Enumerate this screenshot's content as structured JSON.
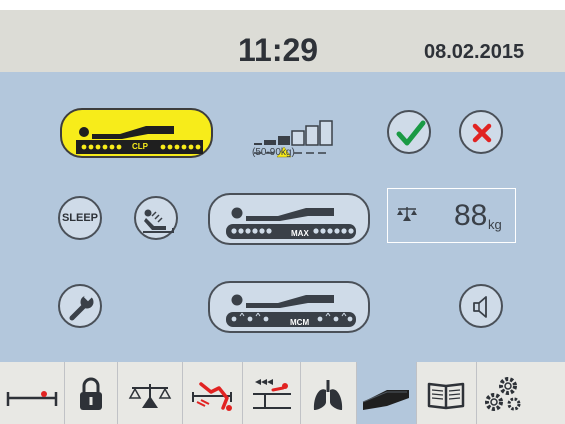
{
  "header": {
    "time": "11:29",
    "date": "08.02.2015"
  },
  "mattress": {
    "clp_label": "CLP",
    "max_label": "MAX",
    "mcm_label": "MCM"
  },
  "weight_range": {
    "label": "(50-90kg)",
    "level": 2,
    "max_level": 5
  },
  "buttons": {
    "sleep_label": "SLEEP"
  },
  "weight": {
    "value": "88",
    "unit": "kg"
  },
  "colors": {
    "background": "#b3c7dc",
    "active_pill": "#f7ec1a",
    "confirm_green": "#1a9a44",
    "cancel_red": "#e12322"
  },
  "tabs": [
    {
      "icon": "bed-flat-icon",
      "active": false
    },
    {
      "icon": "padlock-icon",
      "active": false
    },
    {
      "icon": "scale-icon",
      "active": false
    },
    {
      "icon": "patient-exit-alarm-icon",
      "active": false
    },
    {
      "icon": "patient-position-icon",
      "active": false
    },
    {
      "icon": "lungs-icon",
      "active": false
    },
    {
      "icon": "mattress-icon",
      "active": true
    },
    {
      "icon": "book-icon",
      "active": false
    },
    {
      "icon": "gears-icon",
      "active": false
    }
  ]
}
